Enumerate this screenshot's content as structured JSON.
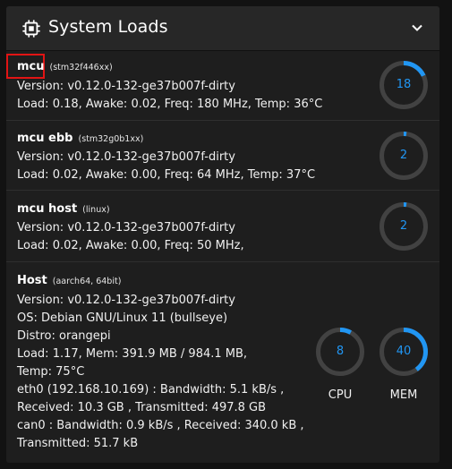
{
  "card": {
    "title": "System Loads",
    "icon": "cpu-chip-icon",
    "collapse_icon": "chevron-down-icon"
  },
  "colors": {
    "accent": "#2196f3",
    "track": "#424242",
    "highlight": "#e11414"
  },
  "mcus": [
    {
      "name": "mcu",
      "chip": "stm32f446xx",
      "version": "Version: v0.12.0-132-ge37b007f-dirty",
      "stats": "Load: 0.18, Awake: 0.02, Freq: 180 MHz, Temp: 36°C",
      "gauge_value": "18",
      "gauge_percent": 18
    },
    {
      "name": "mcu ebb",
      "chip": "stm32g0b1xx",
      "version": "Version: v0.12.0-132-ge37b007f-dirty",
      "stats": "Load: 0.02, Awake: 0.00, Freq: 64 MHz, Temp: 37°C",
      "gauge_value": "2",
      "gauge_percent": 2
    },
    {
      "name": "mcu host",
      "chip": "linux",
      "version": "Version: v0.12.0-132-ge37b007f-dirty",
      "stats": "Load: 0.02, Awake: 0.00, Freq: 50 MHz,",
      "gauge_value": "2",
      "gauge_percent": 2
    }
  ],
  "host": {
    "name": "Host",
    "arch": "aarch64, 64bit",
    "lines": [
      "Version: v0.12.0-132-ge37b007f-dirty",
      "OS: Debian GNU/Linux 11 (bullseye)",
      "Distro: orangepi",
      "Load: 1.17, Mem: 391.9 MB / 984.1 MB,",
      "Temp: 75°C",
      "eth0 (192.168.10.169) : Bandwidth: 5.1 kB/s ,",
      "Received: 10.3 GB , Transmitted: 497.8 GB",
      "can0 : Bandwidth: 0.9 kB/s , Received: 340.0 kB ,",
      "Transmitted: 51.7 kB"
    ],
    "cpu": {
      "label": "CPU",
      "value": "8",
      "percent": 8
    },
    "mem": {
      "label": "MEM",
      "value": "40",
      "percent": 40
    }
  }
}
